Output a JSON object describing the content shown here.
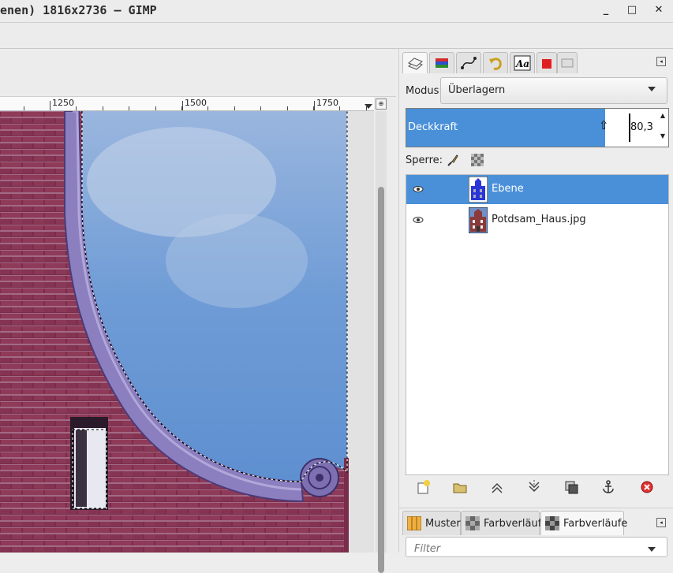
{
  "window": {
    "title": "enen) 1816x2736 – GIMP",
    "minimize_icon": "minimize-icon",
    "maximize_icon": "maximize-icon",
    "close_icon": "close-icon"
  },
  "ruler": {
    "labels": [
      "1250",
      "1500",
      "1750"
    ]
  },
  "layers_panel": {
    "mode_label": "Modus:",
    "mode_value": "Überlagern",
    "opacity_label": "Deckkraft",
    "opacity_value": "80,3",
    "opacity_fraction": 0.803,
    "lock_label": "Sperre:",
    "layers": [
      {
        "name": "Ebene",
        "visible": true,
        "selected": true
      },
      {
        "name": "Potdsam_Haus.jpg",
        "visible": true,
        "selected": false
      }
    ],
    "buttons": [
      "new-layer-icon",
      "new-group-icon",
      "raise-layer-icon",
      "lower-layer-icon",
      "duplicate-layer-icon",
      "anchor-layer-icon",
      "delete-layer-icon"
    ]
  },
  "bottom_dock": {
    "tabs": [
      {
        "label": "Muster",
        "active": false
      },
      {
        "label": "Farbverläufe",
        "active": false
      },
      {
        "label": "Farbverläufe",
        "active": true
      }
    ],
    "filter_placeholder": "Filter"
  },
  "colors": {
    "selection": "#4a90d9",
    "sky": "#7aa6dc",
    "brick": "#7a2d4a"
  }
}
